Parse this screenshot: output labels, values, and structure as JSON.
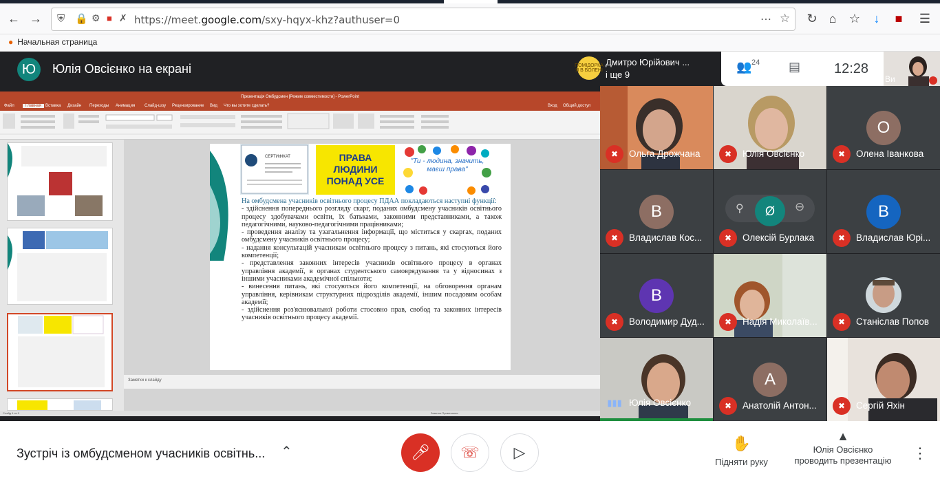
{
  "browser": {
    "url_prefix": "https://meet.",
    "url_domain": "google.com",
    "url_suffix": "/sxy-hqyx-khz?authuser=0",
    "bookmark": "Начальная страница"
  },
  "meet": {
    "presenter_initial": "Ю",
    "presenter_title": "Юлія Овсієнко на екрані",
    "participants_line1": "Дмитро Юрійович ...",
    "participants_line2": "і ще 9",
    "participants_avatar_text": "ПОМІДОРКА Я В БОЛЕНІ",
    "people_count": "24",
    "clock": "12:28",
    "self_label": "Ви"
  },
  "ppt": {
    "window_title": "Презентація Омбудсмен [Режим совместимости] - PowerPoint",
    "menu": [
      "Файл",
      "Главная",
      "Вставка",
      "Дизайн",
      "Переходы",
      "Анимация",
      "Слайд-шоу",
      "Рецензирование",
      "Вид",
      "Что вы хотите сделать?",
      "Вход",
      "Общий доступ"
    ],
    "notes_placeholder": "Заметки к слайду",
    "status_left": "Слайд 4 из 9",
    "status_right": "Заметки   Примечания",
    "slide": {
      "cert_label": "СЕРТИФІКАТ",
      "rights_poster": "ПРАВА ЛЮДИНИ ПОНАД УСЕ",
      "hands_poster": "\"Ти - людина, значить, маєш права\"",
      "lead": "На омбудсмена учасників освітнього процесу ПДАА покладаються наступні функції:",
      "paragraphs": [
        "- здійснення попереднього розгляду скарг, поданих омбудсмену учасників освітнього процесу здобувачами освіти, їх батьками, законними представниками, а також педагогічними, науково-педагогічними працівниками;",
        "- проведення аналізу та узагальнення інформації, що міститься у скаргах, поданих омбудсмену учасників освітнього процесу;",
        " - надання консультацій учасникам освітнього процесу з питань, які стосуються його компетенції;",
        "- представлення законних інтересів учасників освітнього процесу в органах управління академії, в органах студентського самоврядування та у відносинах з іншими учасниками академічної спільноти;",
        "- винесення питань, які стосуються його компетенції, на обговорення органам управління, керівникам структурних підрозділів академії, іншим посадовим особам академії;",
        "- здійснення роз'яснювальної роботи стосовно прав, свобод та законних інтересів учасників освітнього процесу академії."
      ]
    }
  },
  "tiles": [
    {
      "name": "Ольга Дрожчана",
      "type": "video"
    },
    {
      "name": "Юлія Овсієнко",
      "type": "video"
    },
    {
      "name": "Олена Іванкова",
      "type": "avatar",
      "initial": "О",
      "color": "#8d6e63"
    },
    {
      "name": "Владислав Кос...",
      "type": "avatar",
      "initial": "В",
      "color": "#8d6e63"
    },
    {
      "name": "Олексій Бурлака",
      "type": "avatar",
      "initial": "",
      "color": "#12857c"
    },
    {
      "name": "Владислав Юрі...",
      "type": "avatar",
      "initial": "В",
      "color": "#1565c0"
    },
    {
      "name": "Володимир Дуд...",
      "type": "avatar",
      "initial": "В",
      "color": "#5e35b1"
    },
    {
      "name": "Надія Миколаїв...",
      "type": "video"
    },
    {
      "name": "Станіслав Попов",
      "type": "video"
    },
    {
      "name": "Юлія Овсієнко",
      "type": "video"
    },
    {
      "name": "Анатолій Антон...",
      "type": "avatar",
      "initial": "А",
      "color": "#8d6e63"
    },
    {
      "name": "Сергій Яхін",
      "type": "video"
    }
  ],
  "bottom": {
    "meeting_title": "Зустріч із омбудсменом учасників освітнь...",
    "raise_hand": "Підняти руку",
    "presenting_line1": "Юлія Овсієнко",
    "presenting_line2": "проводить презентацію"
  },
  "colors": {
    "meet_dark": "#202124",
    "mute_red": "#d93025",
    "ppt_accent": "#b7472a",
    "avatar_teal": "#12857c"
  }
}
